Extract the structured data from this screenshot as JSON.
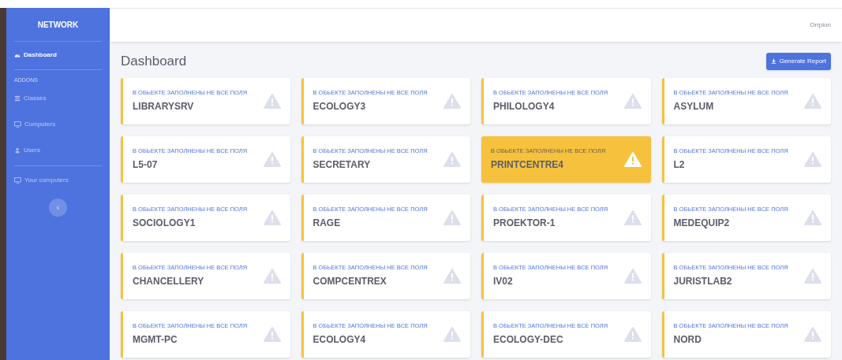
{
  "sidebar": {
    "brand": "NETWORK",
    "items": [
      {
        "kind": "link",
        "label": "Dashboard",
        "selected": true
      },
      {
        "kind": "divider"
      },
      {
        "kind": "heading",
        "label": "ADDONS"
      },
      {
        "kind": "link",
        "label": "Classes",
        "selected": false
      },
      {
        "kind": "link",
        "label": "Computers",
        "selected": false
      },
      {
        "kind": "link",
        "label": "Users",
        "selected": false
      },
      {
        "kind": "divider"
      },
      {
        "kind": "link",
        "label": "Your computers",
        "selected": false
      }
    ],
    "toggle": "‹"
  },
  "topbar": {
    "user": "Orrpion"
  },
  "page": {
    "title": "Dashboard",
    "button": "Generate Report"
  },
  "cards": [
    {
      "note": "В ОБЬЕКТЕ ЗАПОЛНЕНЫ НЕ ВСЕ ПОЛЯ",
      "name": "LIBRARYSRV",
      "highlighted": false
    },
    {
      "note": "В ОБЬЕКТЕ ЗАПОЛНЕНЫ НЕ ВСЕ ПОЛЯ",
      "name": "ECOLOGY3",
      "highlighted": false
    },
    {
      "note": "В ОБЬЕКТЕ ЗАПОЛНЕНЫ НЕ ВСЕ ПОЛЯ",
      "name": "PHILOLOGY4",
      "highlighted": false
    },
    {
      "note": "В ОБЬЕКТЕ ЗАПОЛНЕНЫ НЕ ВСЕ ПОЛЯ",
      "name": "ASYLUM",
      "highlighted": false
    },
    {
      "note": "В ОБЬЕКТЕ ЗАПОЛНЕНЫ НЕ ВСЕ ПОЛЯ",
      "name": "L5-07",
      "highlighted": false
    },
    {
      "note": "В ОБЬЕКТЕ ЗАПОЛНЕНЫ НЕ ВСЕ ПОЛЯ",
      "name": "SECRETARY",
      "highlighted": false
    },
    {
      "note": "В ОБЬЕКТЕ ЗАПОЛНЕНЫ НЕ ВСЕ ПОЛЯ",
      "name": "PRINTCENTRE4",
      "highlighted": true
    },
    {
      "note": "В ОБЬЕКТЕ ЗАПОЛНЕНЫ НЕ ВСЕ ПОЛЯ",
      "name": "L2",
      "highlighted": false
    },
    {
      "note": "В ОБЬЕКТЕ ЗАПОЛНЕНЫ НЕ ВСЕ ПОЛЯ",
      "name": "SOCIOLOGY1",
      "highlighted": false
    },
    {
      "note": "В ОБЬЕКТЕ ЗАПОЛНЕНЫ НЕ ВСЕ ПОЛЯ",
      "name": "RAGE",
      "highlighted": false
    },
    {
      "note": "В ОБЬЕКТЕ ЗАПОЛНЕНЫ НЕ ВСЕ ПОЛЯ",
      "name": "PROEKTOR-1",
      "highlighted": false
    },
    {
      "note": "В ОБЬЕКТЕ ЗАПОЛНЕНЫ НЕ ВСЕ ПОЛЯ",
      "name": "MEDEQUIP2",
      "highlighted": false
    },
    {
      "note": "В ОБЬЕКТЕ ЗАПОЛНЕНЫ НЕ ВСЕ ПОЛЯ",
      "name": "CHANCELLERY",
      "highlighted": false
    },
    {
      "note": "В ОБЬЕКТЕ ЗАПОЛНЕНЫ НЕ ВСЕ ПОЛЯ",
      "name": "COMPCENTREX",
      "highlighted": false
    },
    {
      "note": "В ОБЬЕКТЕ ЗАПОЛНЕНЫ НЕ ВСЕ ПОЛЯ",
      "name": "IV02",
      "highlighted": false
    },
    {
      "note": "В ОБЬЕКТЕ ЗАПОЛНЕНЫ НЕ ВСЕ ПОЛЯ",
      "name": "JURISTLAB2",
      "highlighted": false
    },
    {
      "note": "В ОБЬЕКТЕ ЗАПОЛНЕНЫ НЕ ВСЕ ПОЛЯ",
      "name": "MGMT-PC",
      "highlighted": false
    },
    {
      "note": "В ОБЬЕКТЕ ЗАПОЛНЕНЫ НЕ ВСЕ ПОЛЯ",
      "name": "ECOLOGY4",
      "highlighted": false
    },
    {
      "note": "В ОБЬЕКТЕ ЗАПОЛНЕНЫ НЕ ВСЕ ПОЛЯ",
      "name": "ECOLOGY-DEC",
      "highlighted": false
    },
    {
      "note": "В ОБЬЕКТЕ ЗАПОЛНЕНЫ НЕ ВСЕ ПОЛЯ",
      "name": "NORD",
      "highlighted": false
    }
  ]
}
